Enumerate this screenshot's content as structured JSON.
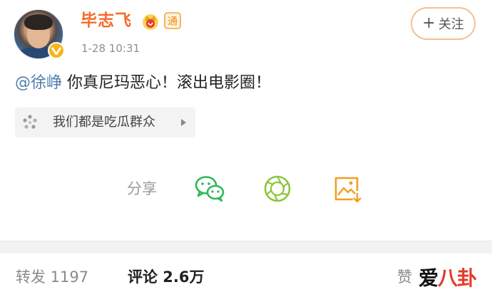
{
  "post": {
    "username": "毕志飞",
    "crown_icon": "crown-icon",
    "tong_badge": "通",
    "timestamp": "1-28 10:31",
    "follow_label": "关注",
    "follow_plus": "+",
    "mention": "@徐峥",
    "text": " 你真尼玛恶心！滚出电影圈！",
    "topic": "我们都是吃瓜群众",
    "verified_icon": "verified-v-icon"
  },
  "share": {
    "label": "分享",
    "items": [
      "wechat-icon",
      "moments-icon",
      "save-image-icon"
    ]
  },
  "stats": {
    "repost": "转发 1197",
    "comment": "评论 2.6万",
    "like": "赞"
  },
  "watermark": {
    "part1": "爱",
    "part2": "八卦"
  },
  "colors": {
    "username": "#f56b2a",
    "mention": "#4f7cab",
    "follow_border": "#f2c291",
    "share_green": "#2fb85a",
    "moments_green": "#8cc63f",
    "save_orange": "#f0a020",
    "verified_gold": "#f6b51c"
  }
}
